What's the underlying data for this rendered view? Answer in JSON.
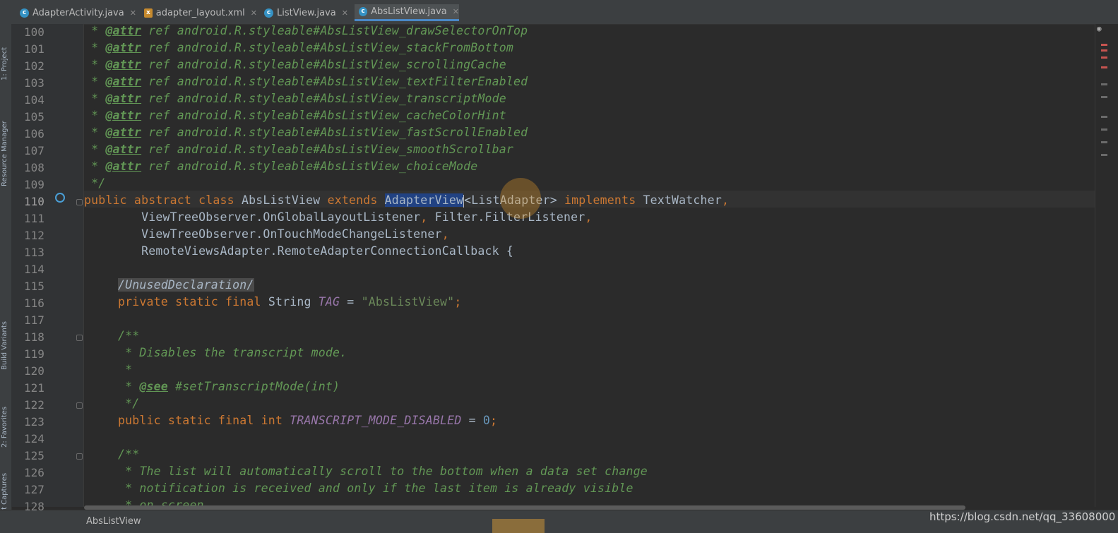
{
  "tabs": [
    {
      "label": "AdapterActivity.java",
      "icon": "class-icon"
    },
    {
      "label": "adapter_layout.xml",
      "icon": "xml-icon"
    },
    {
      "label": "ListView.java",
      "icon": "class-icon"
    },
    {
      "label": "AbsListView.java",
      "icon": "class-icon",
      "active": true
    }
  ],
  "tool_strip": {
    "project": "1: Project",
    "resource_manager": "Resource Manager",
    "build_variants": "Build Variants",
    "favorites": "2: Favorites",
    "layout_captures": "Layout Captures"
  },
  "line_numbers": [
    "100",
    "101",
    "102",
    "103",
    "104",
    "105",
    "106",
    "107",
    "108",
    "109",
    "110",
    "111",
    "112",
    "113",
    "114",
    "115",
    "116",
    "117",
    "118",
    "119",
    "120",
    "121",
    "122",
    "123",
    "124",
    "125",
    "126",
    "127",
    "128"
  ],
  "code": {
    "l100": {
      "star": " * ",
      "tag": "@attr",
      "rest": " ref android.R.styleable#AbsListView_drawSelectorOnTop"
    },
    "l101": {
      "star": " * ",
      "tag": "@attr",
      "rest": " ref android.R.styleable#AbsListView_stackFromBottom"
    },
    "l102": {
      "star": " * ",
      "tag": "@attr",
      "rest": " ref android.R.styleable#AbsListView_scrollingCache"
    },
    "l103": {
      "star": " * ",
      "tag": "@attr",
      "rest": " ref android.R.styleable#AbsListView_textFilterEnabled"
    },
    "l104": {
      "star": " * ",
      "tag": "@attr",
      "rest": " ref android.R.styleable#AbsListView_transcriptMode"
    },
    "l105": {
      "star": " * ",
      "tag": "@attr",
      "rest": " ref android.R.styleable#AbsListView_cacheColorHint"
    },
    "l106": {
      "star": " * ",
      "tag": "@attr",
      "rest": " ref android.R.styleable#AbsListView_fastScrollEnabled"
    },
    "l107": {
      "star": " * ",
      "tag": "@attr",
      "rest": " ref android.R.styleable#AbsListView_smoothScrollbar"
    },
    "l108": {
      "star": " * ",
      "tag": "@attr",
      "rest": " ref android.R.styleable#AbsListView_choiceMode"
    },
    "l109": " */",
    "l110": {
      "kw1": "public abstract class",
      "name": " AbsListView ",
      "kw2": "extends",
      "sp": " ",
      "sel": "AdapterView",
      "generic": "<ListAdapter> ",
      "kw3": "implements",
      "iface": " TextWatcher",
      "comma": ","
    },
    "l111": {
      "a": "        ViewTreeObserver.OnGlobalLayoutListener",
      "c1": ",",
      "b": " Filter.FilterListener",
      "c2": ","
    },
    "l112": {
      "a": "        ViewTreeObserver.OnTouchModeChangeListener",
      "c1": ","
    },
    "l113": "        RemoteViewsAdapter.RemoteAdapterConnectionCallback {",
    "l115": "/UnusedDeclaration/",
    "l116": {
      "kw": "private static final",
      "type": " String ",
      "const": "TAG",
      "eq": " = ",
      "str": "\"AbsListView\"",
      "semi": ";"
    },
    "l118": "/**",
    "l119": " * Disables the transcript mode.",
    "l120": " *",
    "l121": {
      "star": " * ",
      "tag": "@see",
      "rest": " #setTranscriptMode(int)"
    },
    "l122": " */",
    "l123": {
      "kw": "public static final int",
      "sp": " ",
      "const": "TRANSCRIPT_MODE_DISABLED",
      "eq": " = ",
      "num": "0",
      "semi": ";"
    },
    "l125": "/**",
    "l126": " * The list will automatically scroll to the bottom when a data set change",
    "l127": " * notification is received and only if the last item is already visible",
    "l128": " * on screen."
  },
  "status": {
    "breadcrumb": "AbsListView",
    "watermark": "https://blog.csdn.net/qq_33608000"
  },
  "colors": {
    "background": "#2b2b2b",
    "keyword": "#cc7832",
    "comment": "#629755",
    "string": "#6a8759",
    "number": "#6897bb",
    "constant": "#9876aa",
    "selection": "#214283"
  }
}
